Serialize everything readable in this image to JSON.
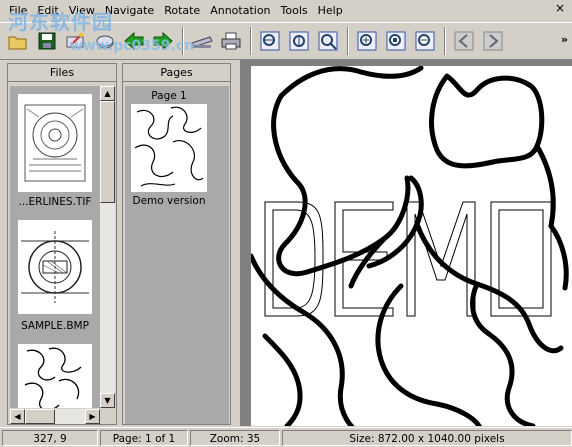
{
  "menu": {
    "items": [
      "File",
      "Edit",
      "View",
      "Navigate",
      "Rotate",
      "Annotation",
      "Tools",
      "Help"
    ],
    "close": "×"
  },
  "toolbar": {
    "buttons": [
      {
        "name": "open-folder-icon"
      },
      {
        "name": "save-icon"
      },
      {
        "name": "scan-icon"
      },
      {
        "name": "disk-icon"
      },
      {
        "name": "previous-arrow-icon"
      },
      {
        "name": "next-arrow-icon"
      },
      {
        "name": "scanner-icon"
      },
      {
        "name": "print-icon"
      },
      {
        "name": "fit-width-icon"
      },
      {
        "name": "fit-height-icon"
      },
      {
        "name": "fit-page-icon"
      },
      {
        "name": "zoom-in-icon"
      },
      {
        "name": "actual-size-icon"
      },
      {
        "name": "zoom-out-icon"
      },
      {
        "name": "back-icon"
      },
      {
        "name": "forward-icon"
      }
    ],
    "more": "»"
  },
  "watermark": {
    "main": "河东软件园",
    "sub": "www.pc0359.cn"
  },
  "files_panel": {
    "title": "Files",
    "items": [
      {
        "label": "...ERLINES.TIF"
      },
      {
        "label": "SAMPLE.BMP"
      },
      {
        "label": ""
      }
    ]
  },
  "pages_panel": {
    "title": "Pages",
    "pages": [
      {
        "label": "Page 1",
        "caption": "Demo version"
      }
    ]
  },
  "viewer": {
    "overlay_text": "DEMO"
  },
  "status": {
    "coords": "327, 9",
    "page": "Page: 1 of 1",
    "zoom": "Zoom: 35",
    "size": "Size: 872.00 x 1040.00 pixels"
  }
}
